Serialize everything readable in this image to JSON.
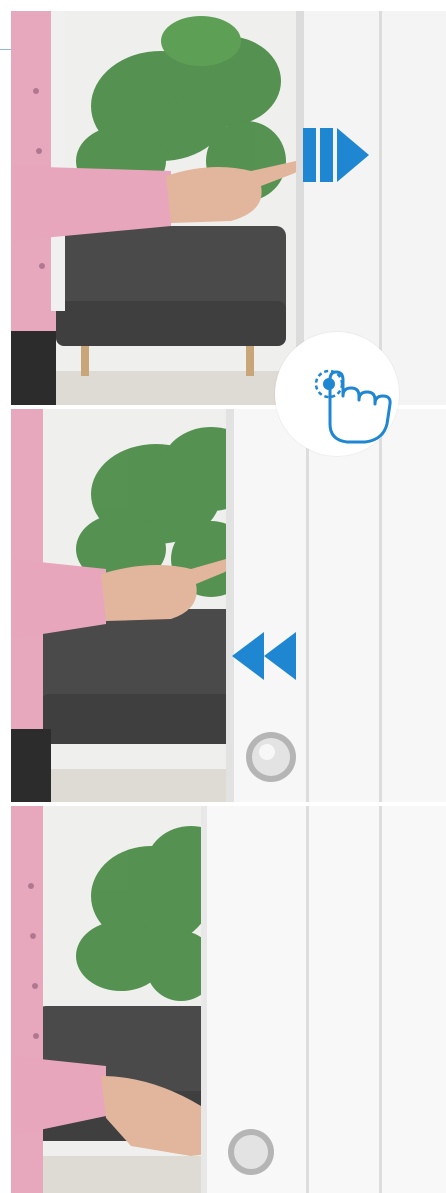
{
  "scene": {
    "panels": [
      {
        "id": "step-1",
        "door_state": "opening-touch"
      },
      {
        "id": "step-2",
        "door_state": "closing"
      },
      {
        "id": "step-3",
        "door_state": "closed-hand-on-handle"
      }
    ],
    "icons": {
      "open_arrow": "play-pause-right-arrow-icon",
      "close_arrow": "rewind-double-arrow-icon",
      "touch": "hand-tap-icon"
    },
    "colors": {
      "accent_blue": "#1f86d1",
      "sweater_pink": "#e9a9bf",
      "plant_green": "#2f7a2a",
      "sofa_gray": "#4b4b4b",
      "door_white": "#f6f6f6"
    }
  }
}
